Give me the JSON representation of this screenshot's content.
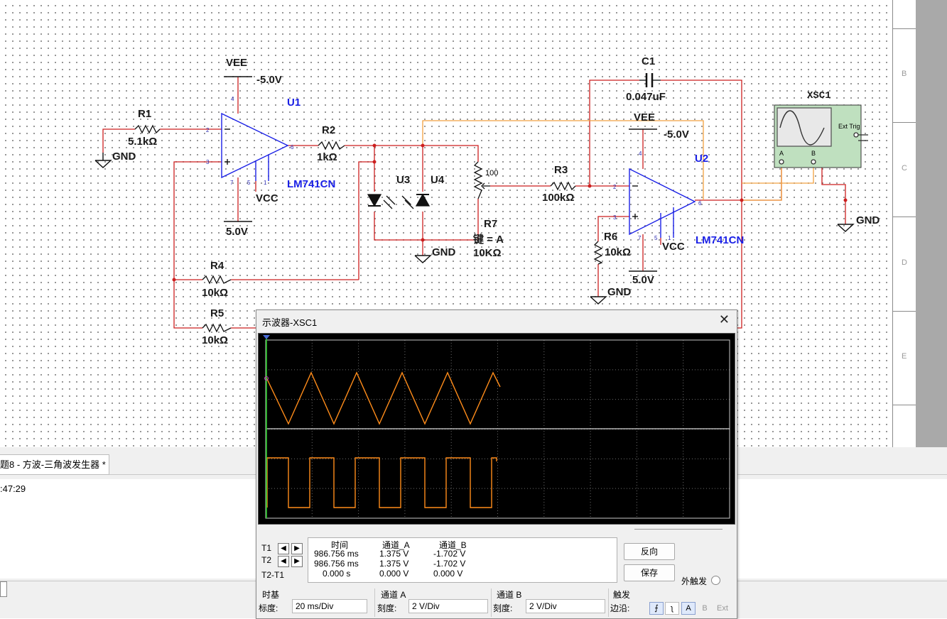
{
  "schematic": {
    "vee_label": "VEE",
    "vee_value": "-5.0V",
    "vcc_label": "VCC",
    "vcc_value": "5.0V",
    "gnd_label": "GND",
    "opamp_model": "LM741CN",
    "u1": "U1",
    "u2": "U2",
    "u3": "U3",
    "u4": "U4",
    "r1": {
      "name": "R1",
      "value": "5.1kΩ"
    },
    "r2": {
      "name": "R2",
      "value": "1kΩ"
    },
    "r3": {
      "name": "R3",
      "value": "100kΩ"
    },
    "r4": {
      "name": "R4",
      "value": "10kΩ"
    },
    "r5": {
      "name": "R5",
      "value": "10kΩ"
    },
    "r6": {
      "name": "R6",
      "value": "10kΩ"
    },
    "r7": {
      "name": "R7",
      "key": "键 = A",
      "value": "10KΩ",
      "percent": "100"
    },
    "c1": {
      "name": "C1",
      "value": "0.047uF"
    },
    "xsc1": {
      "name": "XSC1",
      "ext_trig": "Ext Trig",
      "ch_a": "A",
      "ch_b": "B"
    },
    "pins": {
      "p2": "2",
      "p3": "3",
      "p4": "4",
      "p5": "5",
      "p6": "6",
      "p7": "7",
      "p1": "1"
    }
  },
  "sheet_border": {
    "rows": [
      "B",
      "C",
      "D",
      "E"
    ]
  },
  "tab": {
    "label": "题8 - 方波-三角波发生器 *"
  },
  "log": {
    "time_fragment": ":47:29"
  },
  "scope": {
    "title": "示波器-XSC1",
    "close": "✕",
    "readout": {
      "headers": [
        "时间",
        "通道_A",
        "通道_B"
      ],
      "rows": [
        {
          "label": "T1",
          "time": "986.756 ms",
          "a": "1.375 V",
          "b": "-1.702 V"
        },
        {
          "label": "T2",
          "time": "986.756 ms",
          "a": "1.375 V",
          "b": "-1.702 V"
        },
        {
          "label": "T2-T1",
          "time": "0.000 s",
          "a": "0.000 V",
          "b": "0.000 V"
        }
      ]
    },
    "buttons": {
      "reverse": "反向",
      "save": "保存",
      "ext_trigger": "外触发"
    },
    "timebase": {
      "title": "时基",
      "scale_label": "标度:",
      "scale": "20 ms/Div"
    },
    "channel_a": {
      "title": "通道 A",
      "scale_label": "刻度:",
      "scale": "2  V/Div"
    },
    "channel_b": {
      "title": "通道 B",
      "scale_label": "刻度:",
      "scale": "2  V/Div"
    },
    "trigger": {
      "title": "触发",
      "edge_label": "边沿:",
      "a": "A",
      "b": "B",
      "ext": "Ext"
    },
    "waveforms": {
      "channel_a_color": "#ff8c1a",
      "channel_b_color": "#ff8c1a",
      "triangle_periods_shown": 5,
      "square_periods_shown": 5
    }
  },
  "colors": {
    "wire_red": "#cc1f1f",
    "wire_orange": "#f0a040",
    "component_blue": "#1a20e6",
    "scope_bg": "#000000"
  }
}
